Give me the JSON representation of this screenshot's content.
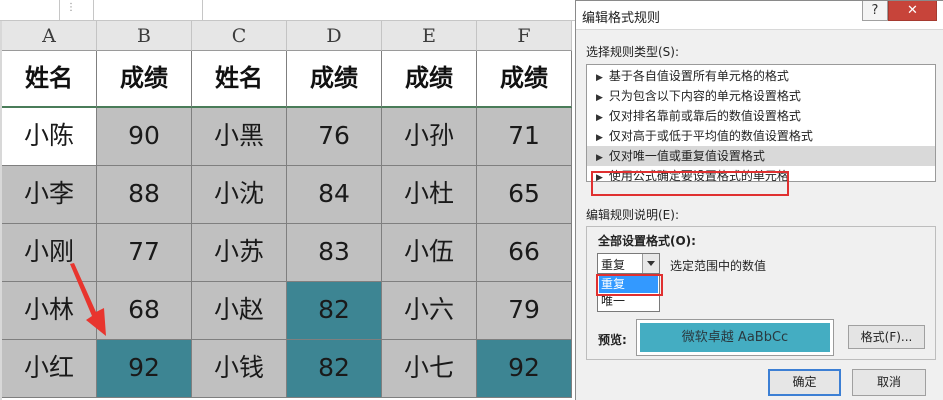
{
  "sheet": {
    "columns": [
      "A",
      "B",
      "C",
      "D",
      "E",
      "F"
    ],
    "rows": [
      [
        "姓名",
        "成绩",
        "姓名",
        "成绩",
        "成绩",
        "成绩"
      ],
      [
        "小陈",
        "90",
        "小黑",
        "76",
        "小孙",
        "71"
      ],
      [
        "小李",
        "88",
        "小沈",
        "84",
        "小杜",
        "65"
      ],
      [
        "小刚",
        "77",
        "小苏",
        "83",
        "小伍",
        "66"
      ],
      [
        "小林",
        "68",
        "小赵",
        "82",
        "小六",
        "79"
      ],
      [
        "小红",
        "92",
        "小钱",
        "82",
        "小七",
        "92"
      ]
    ],
    "highlight_color": "#3d8593",
    "grey_fill": "#c0c0c0"
  },
  "dialog": {
    "title": "编辑格式规则",
    "help_label": "?",
    "close_label": "✕",
    "rule_type_label": "选择规则类型(S):",
    "rule_types": [
      "基于各自值设置所有单元格的格式",
      "只为包含以下内容的单元格设置格式",
      "仅对排名靠前或靠后的数值设置格式",
      "仅对高于或低于平均值的数值设置格式",
      "仅对唯一值或重复值设置格式",
      "使用公式确定要设置格式的单元格"
    ],
    "description_label": "编辑规则说明(E):",
    "format_all_label": "全部设置格式(O):",
    "combo_value": "重复",
    "range_text": "选定范围中的数值",
    "dropdown_options": [
      "重复",
      "唯一"
    ],
    "preview_label": "预览:",
    "preview_text": "微软卓越  AaBbCc",
    "preview_color": "#44adc2",
    "format_button": "格式(F)...",
    "ok_button": "确定",
    "cancel_button": "取消"
  }
}
